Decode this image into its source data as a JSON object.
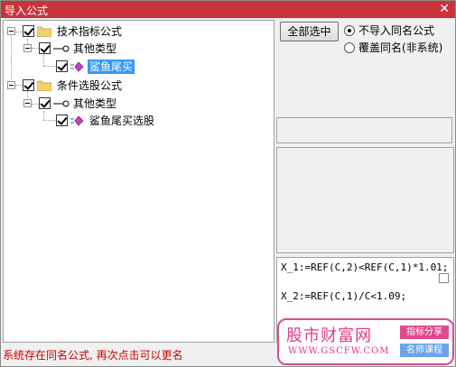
{
  "window": {
    "title": "导入公式",
    "close_glyph": "✕"
  },
  "tree": {
    "items": [
      {
        "label": "技术指标公式",
        "kind": "category",
        "checked": true
      },
      {
        "label": "其他类型",
        "kind": "group",
        "checked": true
      },
      {
        "label": "鲨鱼尾买",
        "kind": "formula",
        "checked": true,
        "selected": true
      },
      {
        "label": "条件选股公式",
        "kind": "category",
        "checked": true
      },
      {
        "label": "其他类型",
        "kind": "group",
        "checked": true
      },
      {
        "label": "鲨鱼尾买选股",
        "kind": "formula",
        "checked": true,
        "selected": false
      }
    ]
  },
  "options": {
    "select_all_label": "全部选中",
    "radio_skip_label": "不导入同名公式",
    "radio_overwrite_label": "覆盖同名(非系统)",
    "selected": "skip"
  },
  "formula": {
    "line1": "X_1:=REF(C,2)<REF(C,1)*1.01;",
    "line2": "X_2:=REF(C,1)/C<1.09;"
  },
  "watermark": {
    "logo_text": "股市财富网",
    "url": "WWW.GSCFW.COM",
    "tag1": "指标分享",
    "tag2": "名师课程"
  },
  "status": {
    "message": "系统存在同名公式, 再次点击可以更名"
  },
  "colors": {
    "titlebar": "#c8343a",
    "selection": "#3399ff",
    "status_text": "#cc0000",
    "watermark": "#e33a86"
  }
}
